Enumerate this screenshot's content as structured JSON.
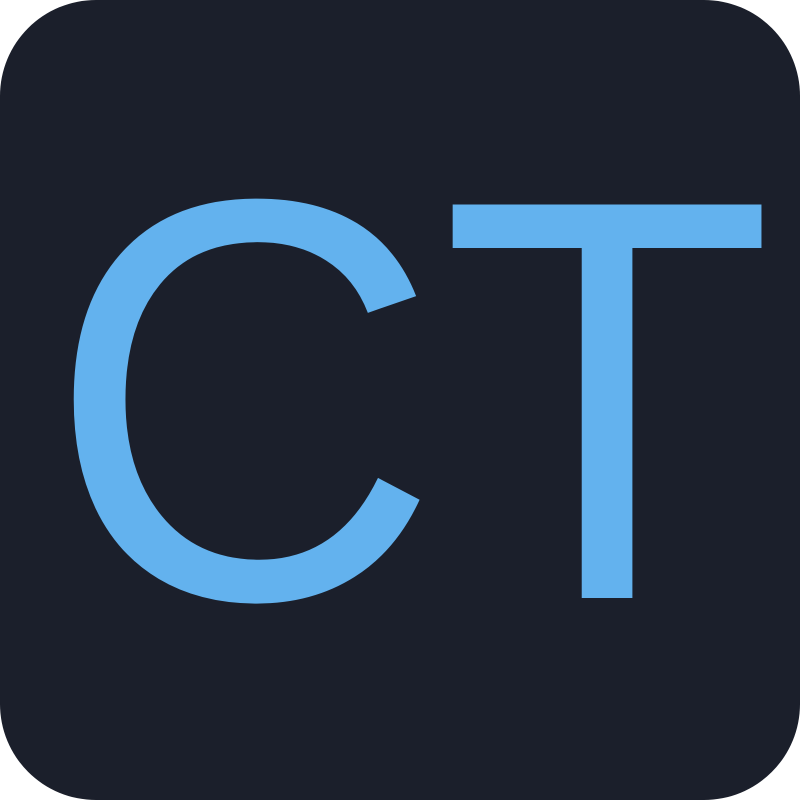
{
  "logo": {
    "monogram": "CT",
    "colors": {
      "background": "#1b1f2b",
      "letters": "#63b2ee"
    }
  }
}
